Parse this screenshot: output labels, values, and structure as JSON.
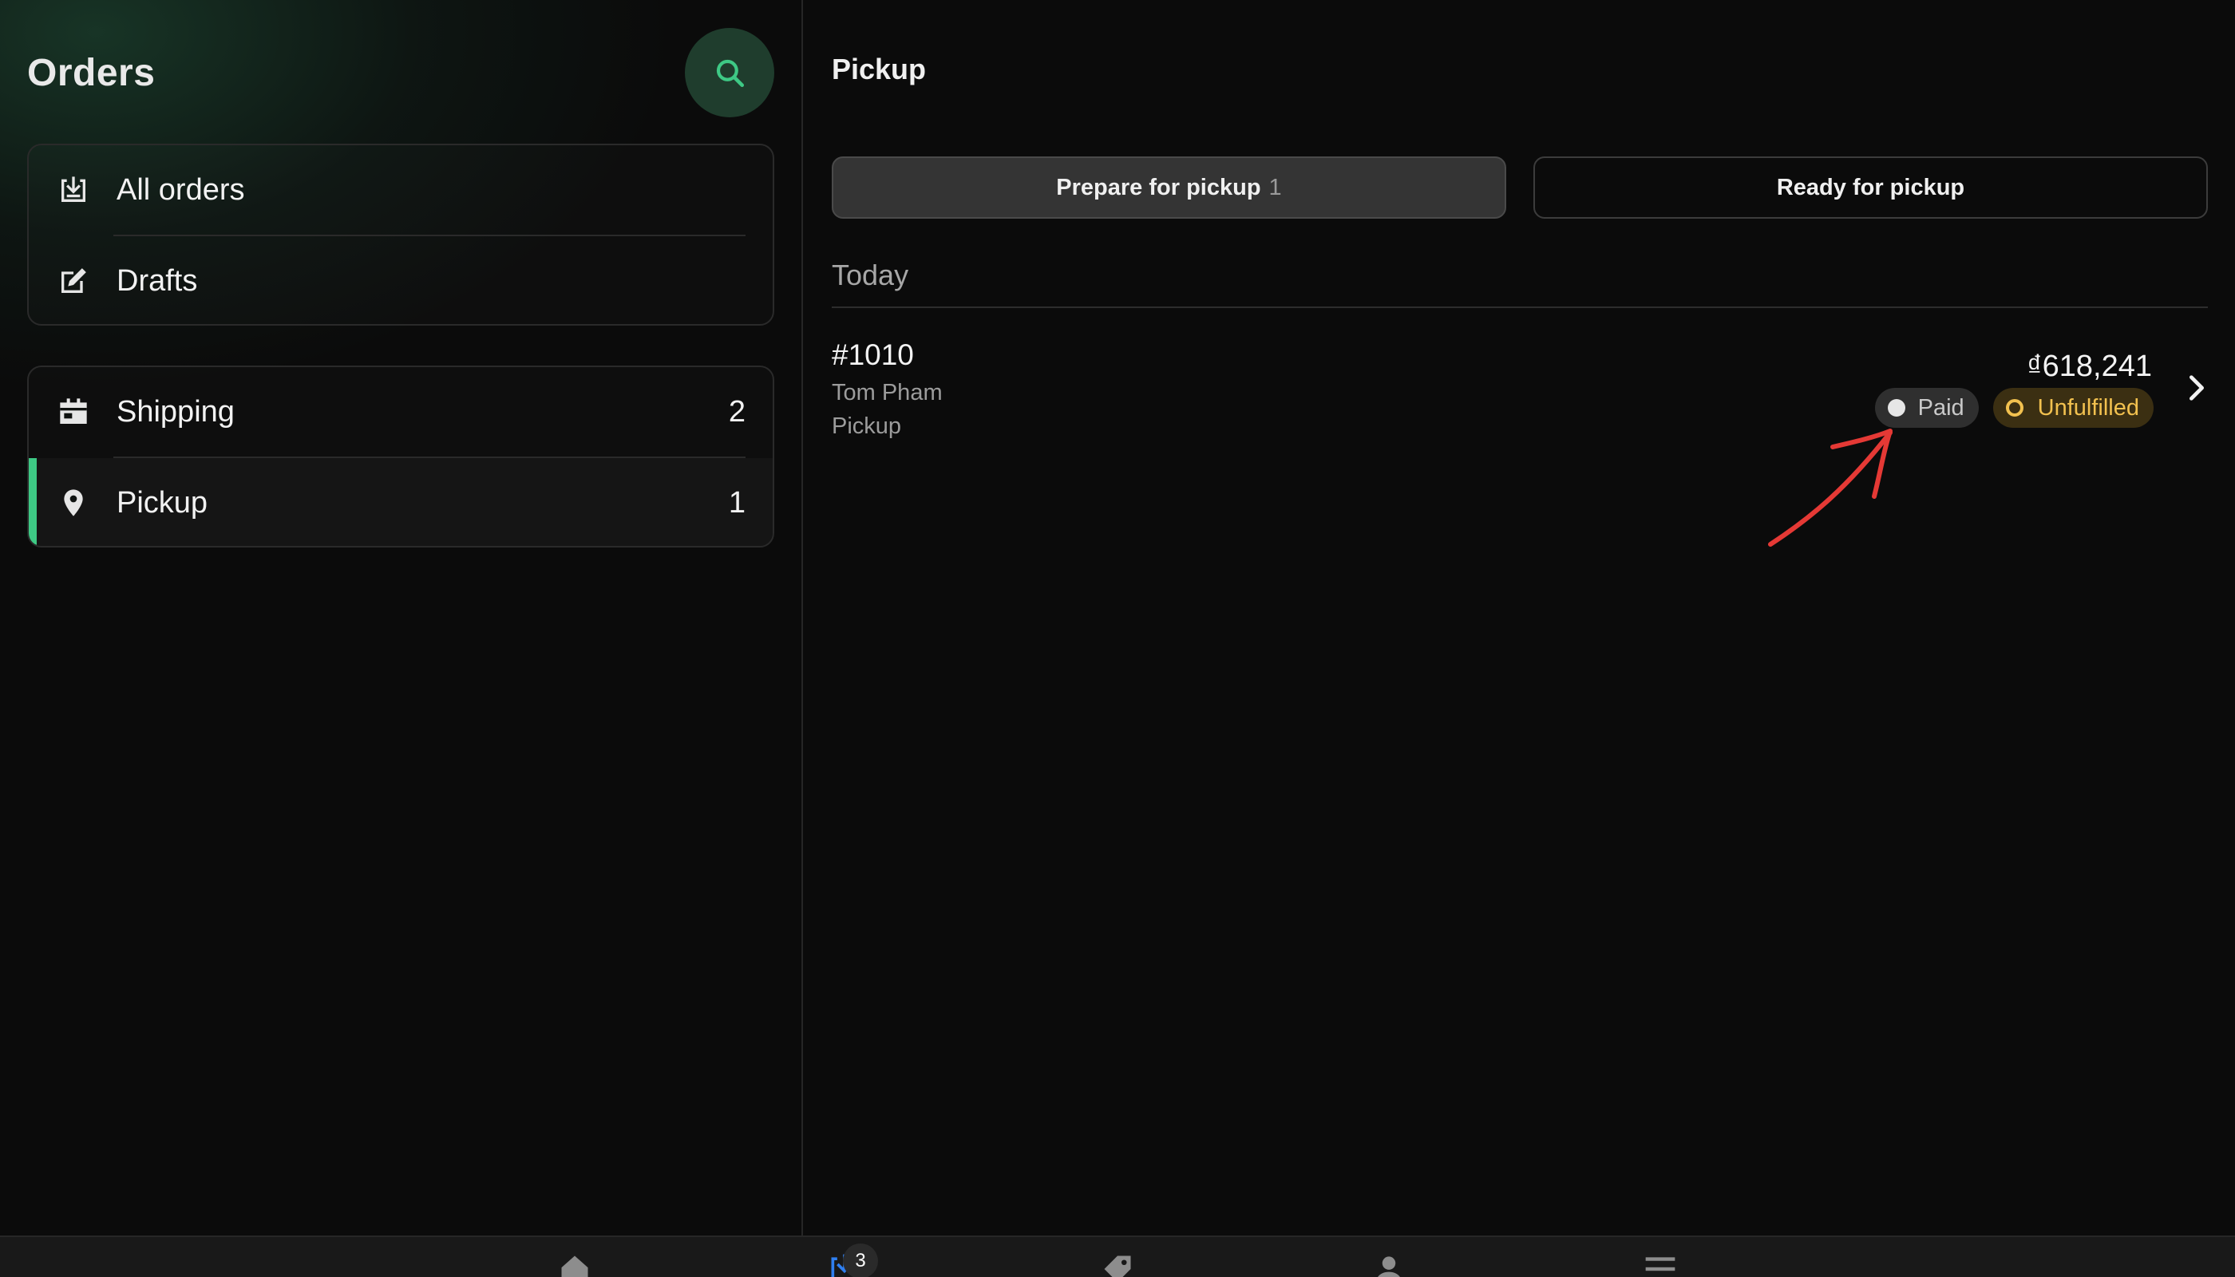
{
  "sidebar": {
    "title": "Orders",
    "group_primary": [
      {
        "label": "All orders",
        "icon": "inbox-download-icon"
      },
      {
        "label": "Drafts",
        "icon": "edit-note-icon"
      }
    ],
    "group_secondary": [
      {
        "label": "Shipping",
        "count": "2",
        "icon": "shipping-box-icon"
      },
      {
        "label": "Pickup",
        "count": "1",
        "icon": "location-pin-icon",
        "active": true
      }
    ]
  },
  "main": {
    "title": "Pickup",
    "tabs": [
      {
        "label": "Prepare for pickup",
        "count": "1",
        "selected": true
      },
      {
        "label": "Ready for pickup",
        "count": ""
      }
    ],
    "section": "Today",
    "orders": [
      {
        "id": "#1010",
        "customer": "Tom Pham",
        "method": "Pickup",
        "total": "₫618,241",
        "payment_status": "Paid",
        "fulfillment_status": "Unfulfilled"
      }
    ]
  },
  "bottom_nav": {
    "items": [
      "home-icon",
      "orders-icon",
      "tag-icon",
      "person-icon",
      "menu-icon"
    ],
    "orders_badge": "3"
  },
  "colors": {
    "accent_green": "#3ec985",
    "paid_badge_bg": "#2f2f2f",
    "unfulfilled_text": "#f2c14f",
    "unfulfilled_bg": "#3b2f12",
    "annotation_red": "#e53935",
    "orders_nav_blue": "#2f7ff0"
  }
}
